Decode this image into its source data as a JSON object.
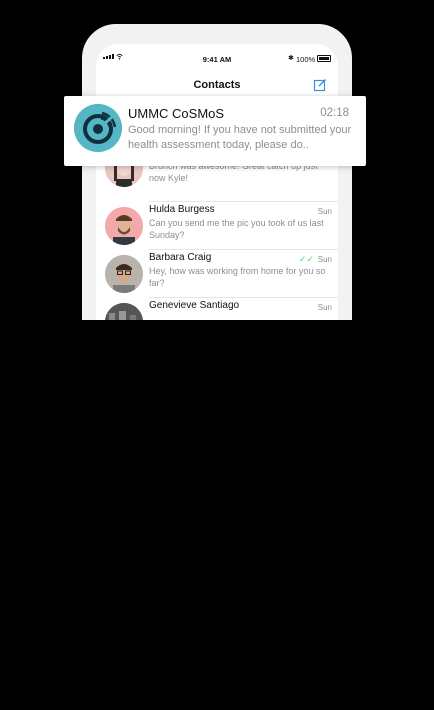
{
  "status_bar": {
    "time": "9:41 AM",
    "battery": "100%",
    "bluetooth_icon": "bluetooth-icon",
    "signal_icon": "signal-bars-icon",
    "wifi_icon": "wifi-icon"
  },
  "nav": {
    "title": "Contacts",
    "compose_icon": "compose-icon"
  },
  "notification": {
    "app_name": "UMMC CoSMoS",
    "time": "02:18",
    "body": "Good morning! If you have not submitted your health assessment today, please do..",
    "icon": "cosmos-logo-icon",
    "accent": "#55b6c5"
  },
  "contacts": [
    {
      "name": "",
      "message": "Brunch was awesome! Great catch up just now Kyle!",
      "date": "",
      "read": false,
      "avatar_bg": "#e9c6c1"
    },
    {
      "name": "Hulda Burgess",
      "message": "Can you send me the pic you took of us last Sunday?",
      "date": "Sun",
      "read": false,
      "avatar_bg": "#f3a9a9"
    },
    {
      "name": "Barbara Craig",
      "message": "Hey, how was working from home for you so far?",
      "date": "Sun",
      "read": true,
      "avatar_bg": "#b9b3ad"
    },
    {
      "name": "Genevieve Santiago",
      "message": "",
      "date": "Sun",
      "read": false,
      "avatar_bg": "#555555"
    }
  ],
  "colors": {
    "read_check": "#4cd964",
    "compose": "#3a8fd8"
  }
}
